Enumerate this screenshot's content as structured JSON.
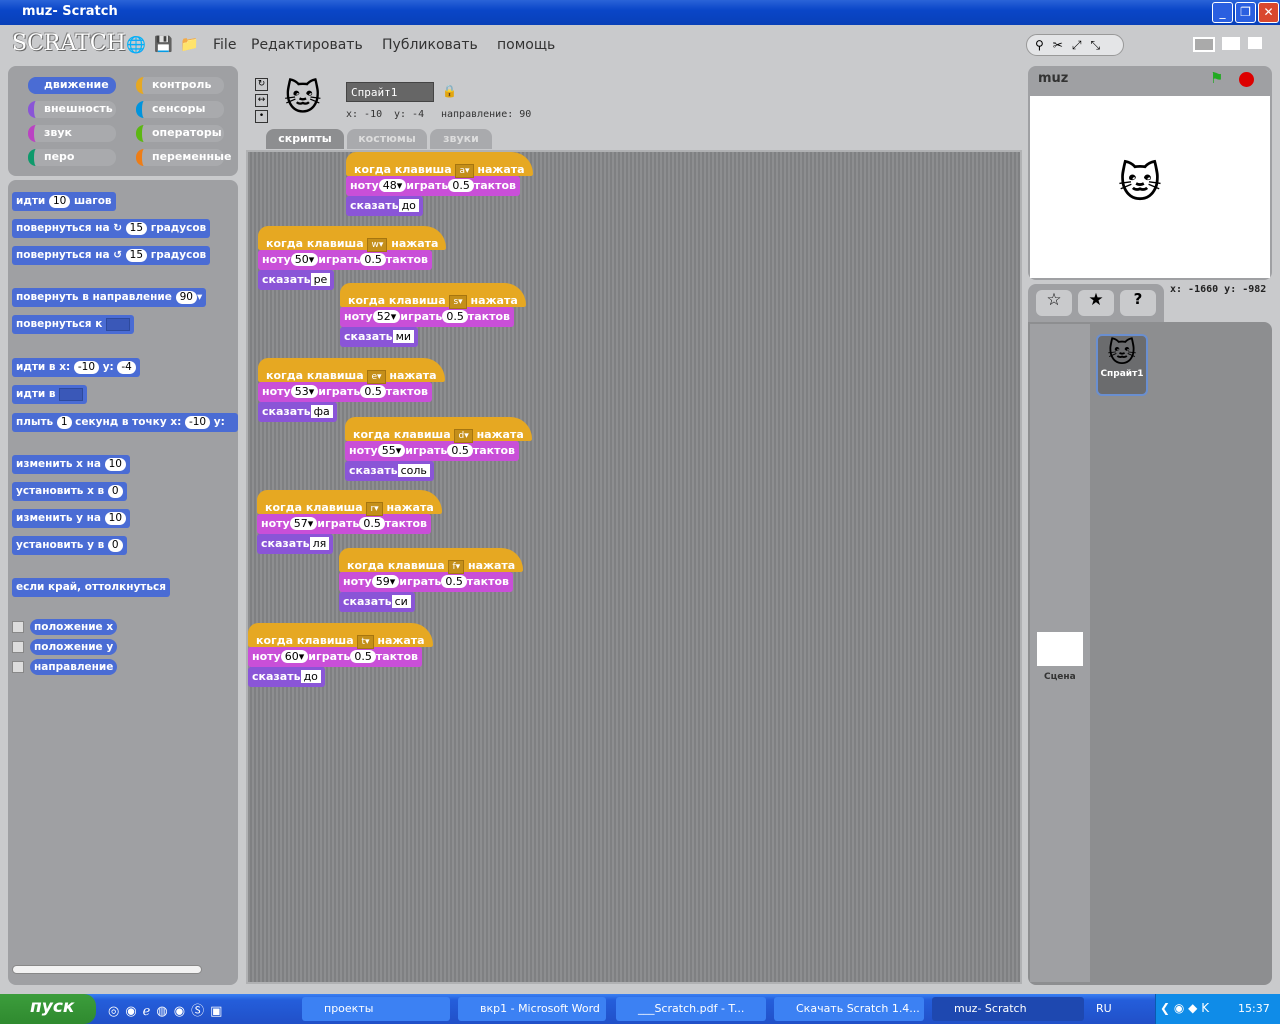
{
  "window": {
    "title": "muz- Scratch"
  },
  "menu": {
    "logo": "SCRATCH",
    "items": [
      "File",
      "Редактировать",
      "Публиковать",
      "помощь"
    ]
  },
  "categories": [
    {
      "label": "движение",
      "color": "#4a6cd4",
      "selected": true
    },
    {
      "label": "контроль",
      "color": "#e6a822"
    },
    {
      "label": "внешность",
      "color": "#8a55d7"
    },
    {
      "label": "сенсоры",
      "color": "#0094dd"
    },
    {
      "label": "звук",
      "color": "#bb42c3"
    },
    {
      "label": "операторы",
      "color": "#5cb712"
    },
    {
      "label": "перо",
      "color": "#0e9a6c"
    },
    {
      "label": "переменные",
      "color": "#ee7d16"
    }
  ],
  "palette": {
    "move": [
      "идти",
      "10",
      "шагов"
    ],
    "turn_right": [
      "повернуться на",
      "15",
      "градусов"
    ],
    "turn_left": [
      "повернуться на",
      "15",
      "градусов"
    ],
    "point_dir": [
      "повернуть в направление",
      "90"
    ],
    "point_to": [
      "повернуться к"
    ],
    "goto_xy": [
      "идти в x:",
      "-10",
      "y:",
      "-4"
    ],
    "goto": [
      "идти в"
    ],
    "glide": [
      "плыть",
      "1",
      "секунд в точку x:",
      "-10",
      "y:"
    ],
    "change_x": [
      "изменить x на",
      "10"
    ],
    "set_x": [
      "установить x в",
      "0"
    ],
    "change_y": [
      "изменить y на",
      "10"
    ],
    "set_y": [
      "установить y в",
      "0"
    ],
    "bounce": "если край, оттолкнуться",
    "reporters": [
      "положение x",
      "положение y",
      "направление"
    ]
  },
  "sprite": {
    "name": "Спрайт1",
    "x_label": "x: -10",
    "y_label": "y: -4",
    "direction_label": "направление: 90"
  },
  "tabs": [
    {
      "label": "скрипты",
      "active": true
    },
    {
      "label": "костюмы"
    },
    {
      "label": "звуки"
    }
  ],
  "block_text": {
    "when": "когда клавиша",
    "pressed": "нажата",
    "note": "ноту",
    "play": "играть",
    "beats": "тактов",
    "say": "сказать"
  },
  "scripts": [
    {
      "key": "a",
      "note": "48",
      "beats": "0.5",
      "say": "до"
    },
    {
      "key": "w",
      "note": "50",
      "beats": "0.5",
      "say": "ре"
    },
    {
      "key": "s",
      "note": "52",
      "beats": "0.5",
      "say": "ми"
    },
    {
      "key": "e",
      "note": "53",
      "beats": "0.5",
      "say": "фа"
    },
    {
      "key": "d",
      "note": "55",
      "beats": "0.5",
      "say": "соль"
    },
    {
      "key": "r",
      "note": "57",
      "beats": "0.5",
      "say": "ля"
    },
    {
      "key": "f",
      "note": "59",
      "beats": "0.5",
      "say": "си"
    },
    {
      "key": "t",
      "note": "60",
      "beats": "0.5",
      "say": "до"
    }
  ],
  "stage": {
    "project_name": "muz",
    "mouse_coords": "x: -1660  y: -982"
  },
  "sprite_list": {
    "sprites": [
      "Спрайт1"
    ],
    "stage_label": "Сцена"
  },
  "taskbar": {
    "start": "пуск",
    "tasks": [
      "проекты",
      "вкр1 - Microsoft Word",
      "___Scratch.pdf - T...",
      "Скачать Scratch 1.4...",
      "muz- Scratch"
    ],
    "lang": "RU",
    "clock": "15:37"
  }
}
